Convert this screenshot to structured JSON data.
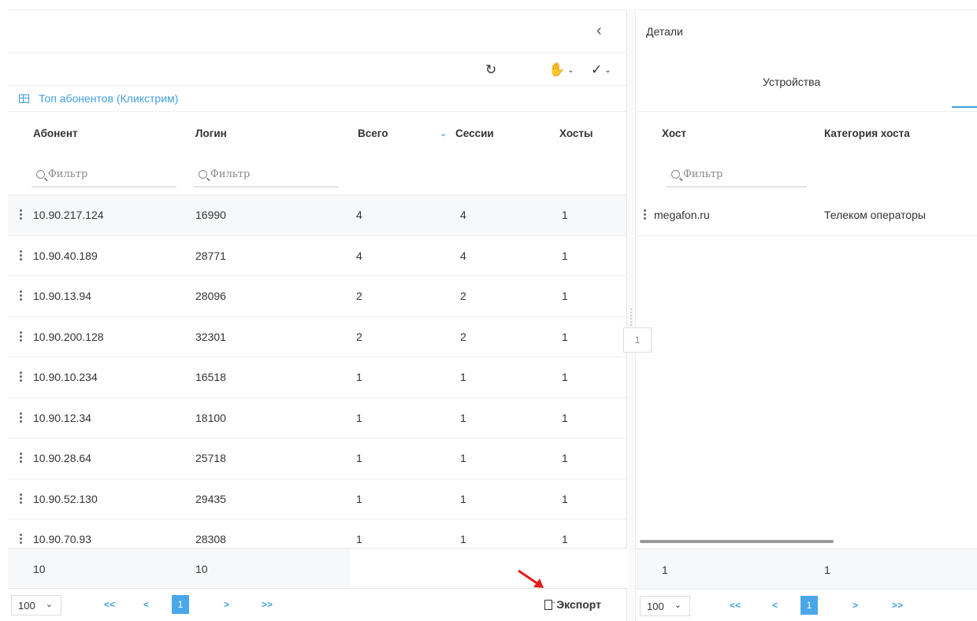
{
  "left": {
    "collapse_icon": "chevron-left-icon",
    "toolbar": {
      "refresh_icon": "refresh-icon",
      "hand_icon": "hand-icon",
      "brush_icon": "brush-icon"
    },
    "table_title": "Топ абонентов (Кликстрим)",
    "columns": [
      "Абонент",
      "Логин",
      "Всего",
      "Сессии",
      "Хосты"
    ],
    "filter_placeholder": "Фильтр",
    "rows": [
      [
        "10.90.217.124",
        "16990",
        "4",
        "4",
        "1"
      ],
      [
        "10.90.40.189",
        "28771",
        "4",
        "4",
        "1"
      ],
      [
        "10.90.13.94",
        "28096",
        "2",
        "2",
        "1"
      ],
      [
        "10.90.200.128",
        "32301",
        "2",
        "2",
        "1"
      ],
      [
        "10.90.10.234",
        "16518",
        "1",
        "1",
        "1"
      ],
      [
        "10.90.12.34",
        "18100",
        "1",
        "1",
        "1"
      ],
      [
        "10.90.28.64",
        "25718",
        "1",
        "1",
        "1"
      ],
      [
        "10.90.52.130",
        "29435",
        "1",
        "1",
        "1"
      ],
      [
        "10.90.70.93",
        "28308",
        "1",
        "1",
        "1"
      ]
    ],
    "footer": {
      "count_abonent": "10",
      "count_login": "10"
    },
    "pager": {
      "page_size": "100",
      "first": "<<",
      "prev": "<",
      "current": "1",
      "next": ">",
      "last": ">>"
    },
    "export_label": "Экспорт"
  },
  "splitter_badge": "1",
  "right": {
    "title": "Детали",
    "tab": "Устройства",
    "columns": [
      "Хост",
      "Категория хоста"
    ],
    "filter_placeholder": "Фильтр",
    "rows": [
      [
        "megafon.ru",
        "Телеком операторы"
      ]
    ],
    "footer": {
      "c1": "1",
      "c2": "1"
    },
    "pager": {
      "page_size": "100",
      "first": "<<",
      "prev": "<",
      "current": "1",
      "next": ">",
      "last": ">>"
    }
  }
}
